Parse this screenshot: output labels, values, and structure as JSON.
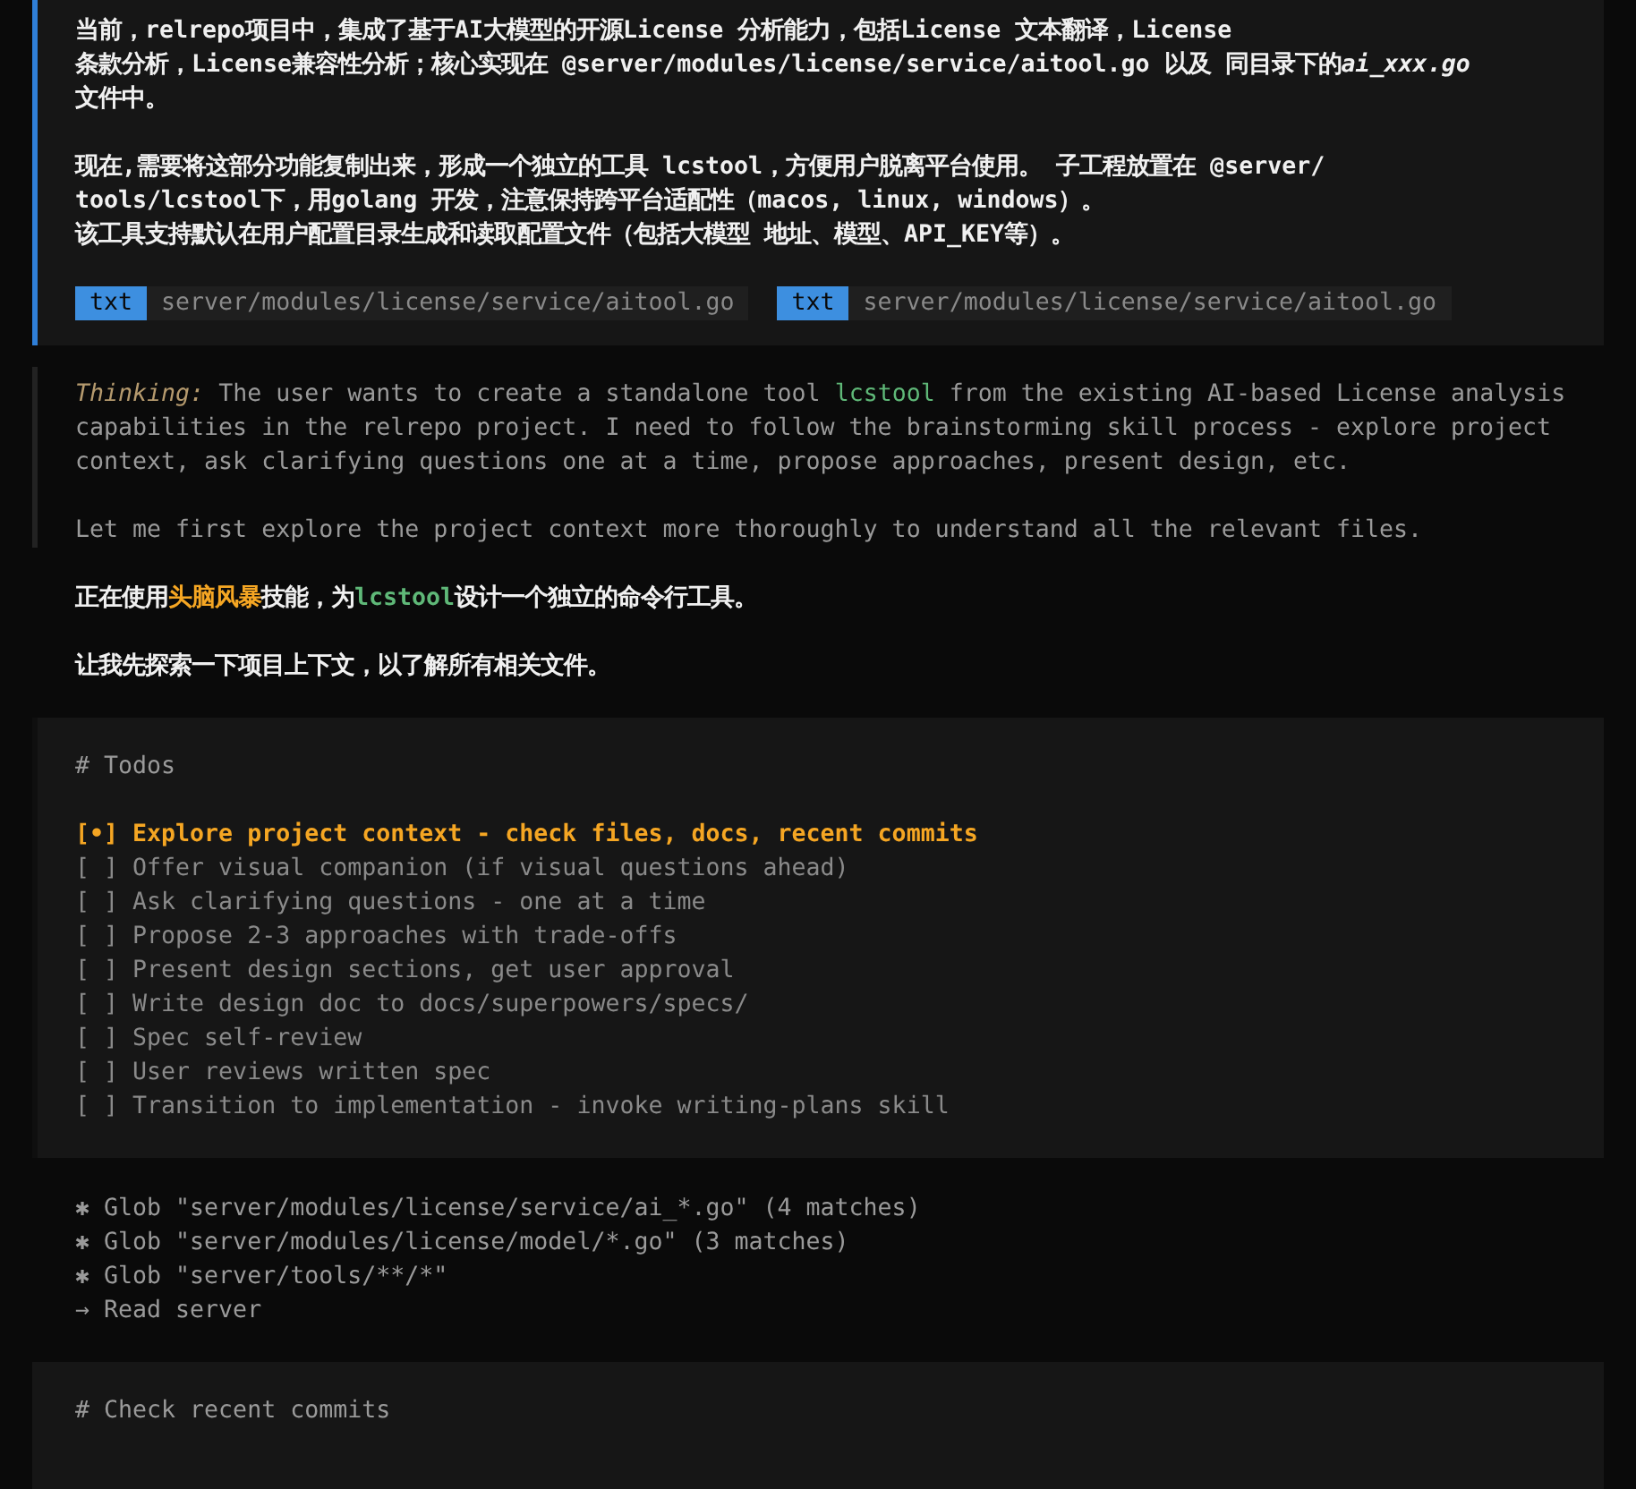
{
  "user_message": {
    "paragraphs": [
      [
        [
          {
            "kind": "plain",
            "text": "当前，relrepo项目中，集成了基于AI大模型的开源License 分析能力，包括License 文本翻译，License"
          }
        ],
        [
          {
            "kind": "plain",
            "text": "条款分析，License兼容性分析；核心实现在 @server/modules/license/service/aitool.go 以及 同目录下的"
          },
          {
            "kind": "italic",
            "text": "ai_xxx.go"
          }
        ],
        [
          {
            "kind": "plain",
            "text": "文件中。"
          }
        ]
      ],
      [
        [
          {
            "kind": "plain",
            "text": "现在,需要将这部分功能复制出来，形成一个独立的工具 lcstool，方便用户脱离平台使用。 子工程放置在 @server/"
          }
        ],
        [
          {
            "kind": "plain",
            "text": "tools/lcstool下，用golang 开发，注意保持跨平台适配性（macos, linux, windows）。"
          }
        ],
        [
          {
            "kind": "plain",
            "text": "该工具支持默认在用户配置目录生成和读取配置文件（包括大模型 地址、模型、API_KEY等）。"
          }
        ]
      ]
    ],
    "attachments": [
      {
        "badge": "txt",
        "path": "server/modules/license/service/aitool.go"
      },
      {
        "badge": "txt",
        "path": "server/modules/license/service/aitool.go"
      }
    ]
  },
  "thinking": {
    "label": "Thinking:",
    "paragraphs": [
      [
        [
          {
            "kind": "plain",
            "text": " The user wants to create a standalone tool "
          },
          {
            "kind": "code",
            "text": "lcstool"
          },
          {
            "kind": "plain",
            "text": " from the existing AI-based License analysis"
          }
        ],
        [
          {
            "kind": "plain",
            "text": "capabilities in the relrepo project. I need to follow the brainstorming skill process - explore project"
          }
        ],
        [
          {
            "kind": "plain",
            "text": "context, ask clarifying questions one at a time, propose approaches, present design, etc."
          }
        ]
      ],
      [
        [
          {
            "kind": "plain",
            "text": "Let me first explore the project context more thoroughly to understand all the relevant files."
          }
        ]
      ]
    ]
  },
  "reply": [
    [
      {
        "kind": "plain",
        "text": "正在使用"
      },
      {
        "kind": "accent",
        "text": "头脑风暴"
      },
      {
        "kind": "plain",
        "text": "技能，为"
      },
      {
        "kind": "code",
        "text": "lcstool"
      },
      {
        "kind": "plain",
        "text": "设计一个独立的命令行工具。"
      }
    ],
    [
      {
        "kind": "plain",
        "text": "让我先探索一下项目上下文，以了解所有相关文件。"
      }
    ]
  ],
  "todos": {
    "title": "# Todos",
    "items": [
      {
        "marker": "[•]",
        "text": "Explore project context - check files, docs, recent commits",
        "active": true
      },
      {
        "marker": "[ ]",
        "text": "Offer visual companion (if visual questions ahead)",
        "active": false
      },
      {
        "marker": "[ ]",
        "text": "Ask clarifying questions - one at a time",
        "active": false
      },
      {
        "marker": "[ ]",
        "text": "Propose 2-3 approaches with trade-offs",
        "active": false
      },
      {
        "marker": "[ ]",
        "text": "Present design sections, get user approval",
        "active": false
      },
      {
        "marker": "[ ]",
        "text": "Write design doc to docs/superpowers/specs/",
        "active": false
      },
      {
        "marker": "[ ]",
        "text": "Spec self-review",
        "active": false
      },
      {
        "marker": "[ ]",
        "text": "User reviews written spec",
        "active": false
      },
      {
        "marker": "[ ]",
        "text": "Transition to implementation - invoke writing-plans skill",
        "active": false
      }
    ]
  },
  "tool_calls": [
    {
      "icon": "✱",
      "text": "Glob \"server/modules/license/service/ai_*.go\" (4 matches)"
    },
    {
      "icon": "✱",
      "text": "Glob \"server/modules/license/model/*.go\" (3 matches)"
    },
    {
      "icon": "✱",
      "text": "Glob \"server/tools/**/*\""
    },
    {
      "icon": "→",
      "text": "Read server"
    }
  ],
  "commits_panel": {
    "title": "# Check recent commits"
  }
}
